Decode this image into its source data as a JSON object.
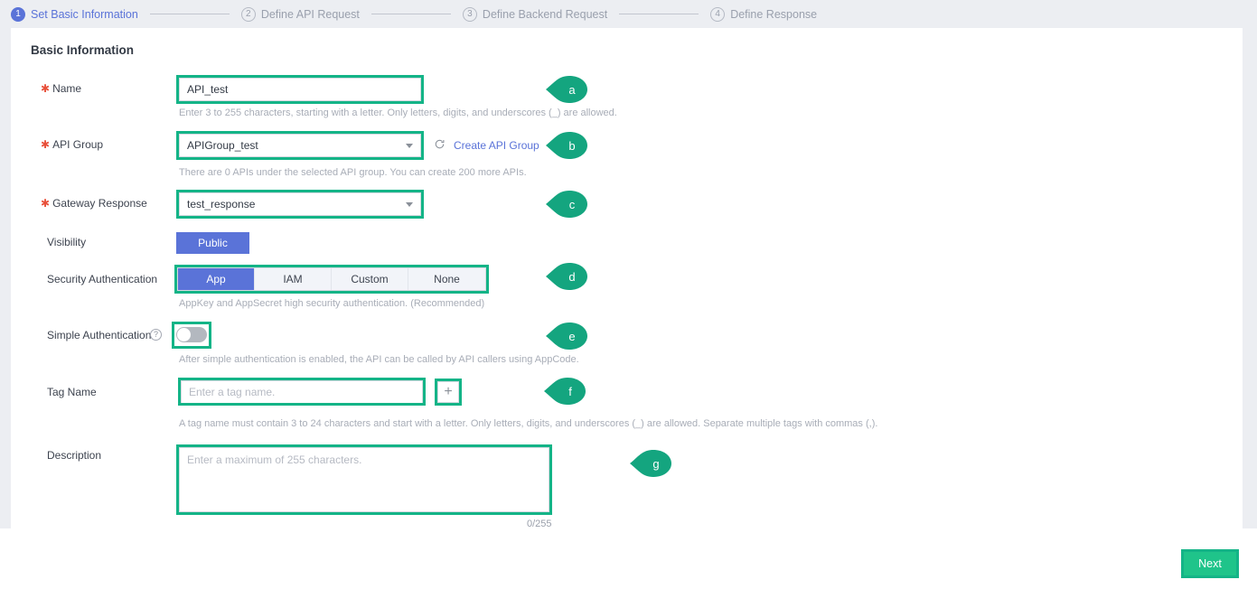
{
  "steps": [
    {
      "num": "1",
      "label": "Set Basic Information",
      "state": "active"
    },
    {
      "num": "2",
      "label": "Define API Request",
      "state": "inactive"
    },
    {
      "num": "3",
      "label": "Define Backend Request",
      "state": "inactive"
    },
    {
      "num": "4",
      "label": "Define Response",
      "state": "inactive"
    }
  ],
  "card": {
    "title": "Basic Information"
  },
  "fields": {
    "name": {
      "label": "Name",
      "required": true,
      "value": "API_test",
      "hint": "Enter 3 to 255 characters, starting with a letter. Only letters, digits, and underscores (_) are allowed."
    },
    "api_group": {
      "label": "API Group",
      "required": true,
      "value": "APIGroup_test",
      "refresh_icon": "refresh-icon",
      "link": "Create API Group",
      "hint": "There are 0 APIs under the selected API group. You can create 200 more APIs."
    },
    "gateway_response": {
      "label": "Gateway Response",
      "required": true,
      "value": "test_response"
    },
    "visibility": {
      "label": "Visibility",
      "value": "Public"
    },
    "security_authentication": {
      "label": "Security Authentication",
      "options": [
        "App",
        "IAM",
        "Custom",
        "None"
      ],
      "selected": "App",
      "hint": "AppKey and AppSecret high security authentication. (Recommended)"
    },
    "simple_authentication": {
      "label": "Simple Authentication",
      "help_icon": "help-icon",
      "toggle_state": "off",
      "hint": "After simple authentication is enabled, the API can be called by API callers using AppCode."
    },
    "tag_name": {
      "label": "Tag Name",
      "placeholder": "Enter a tag name.",
      "value": "",
      "add_icon": "plus-icon",
      "hint": "A tag name must contain 3 to 24 characters and start with a letter. Only letters, digits, and underscores (_) are allowed. Separate multiple tags with commas (,)."
    },
    "description": {
      "label": "Description",
      "placeholder": "Enter a maximum of 255 characters.",
      "value": "",
      "counter": "0/255"
    }
  },
  "callouts": [
    {
      "id": "a",
      "letter": "a"
    },
    {
      "id": "b",
      "letter": "b"
    },
    {
      "id": "c",
      "letter": "c"
    },
    {
      "id": "d",
      "letter": "d"
    },
    {
      "id": "e",
      "letter": "e"
    },
    {
      "id": "f",
      "letter": "f"
    },
    {
      "id": "g",
      "letter": "g"
    }
  ],
  "footer": {
    "next_label": "Next"
  },
  "colors": {
    "highlight_green": "#14b487",
    "primary_blue": "#5a73d8",
    "next_green": "#1fc48a",
    "required_star": "#e8503a",
    "page_bg": "#eceef2"
  }
}
